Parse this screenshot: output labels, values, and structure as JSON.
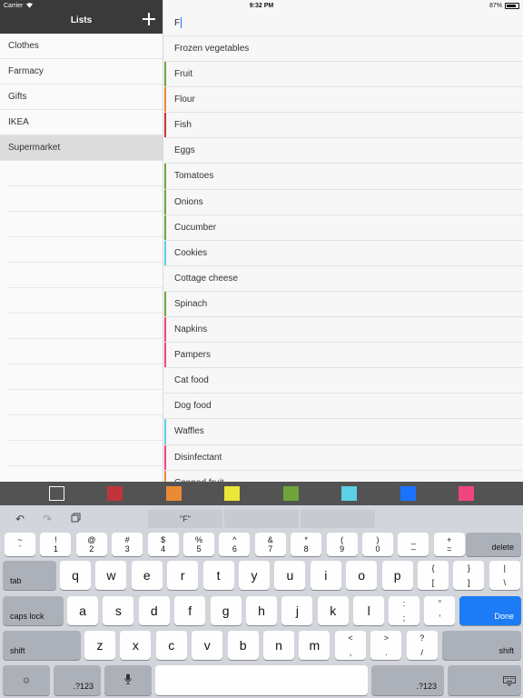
{
  "status": {
    "carrier": "Carrier",
    "time": "9:32 PM",
    "battery": "87%",
    "battery_level": 0.87
  },
  "sidebar": {
    "title": "Lists",
    "items": [
      {
        "label": "Clothes"
      },
      {
        "label": "Farmacy"
      },
      {
        "label": "Gifts"
      },
      {
        "label": "IKEA"
      },
      {
        "label": "Supermarket",
        "selected": true
      }
    ]
  },
  "main": {
    "input_value": "F",
    "items": [
      {
        "label": "Frozen vegetables",
        "color": ""
      },
      {
        "label": "Fruit",
        "color": "#6fa43a"
      },
      {
        "label": "Flour",
        "color": "#e98a35"
      },
      {
        "label": "Fish",
        "color": "#c0343c"
      },
      {
        "label": "Eggs",
        "color": ""
      },
      {
        "label": "Tomatoes",
        "color": "#6fa43a"
      },
      {
        "label": "Onions",
        "color": "#6fa43a"
      },
      {
        "label": "Cucumber",
        "color": "#6fa43a"
      },
      {
        "label": "Cookies",
        "color": "#5ad1e4"
      },
      {
        "label": "Cottage cheese",
        "color": ""
      },
      {
        "label": "Spinach",
        "color": "#6fa43a"
      },
      {
        "label": "Napkins",
        "color": "#f0457f"
      },
      {
        "label": "Pampers",
        "color": "#f0457f"
      },
      {
        "label": "Cat food",
        "color": ""
      },
      {
        "label": "Dog food",
        "color": ""
      },
      {
        "label": "Waffles",
        "color": "#5ad1e4"
      },
      {
        "label": "Disinfectant",
        "color": "#f0457f"
      },
      {
        "label": "Canned fruit",
        "color": "#e98a35"
      }
    ]
  },
  "colors": [
    "#ffffff",
    "#c0343c",
    "#e98a35",
    "#ece638",
    "#6fa43a",
    "#5ad1e4",
    "#1a73ff",
    "#f0457f"
  ],
  "keyboard": {
    "suggestion": "\"F\"",
    "row1": [
      {
        "top": "~",
        "bot": "`"
      },
      {
        "top": "!",
        "bot": "1"
      },
      {
        "top": "@",
        "bot": "2"
      },
      {
        "top": "#",
        "bot": "3"
      },
      {
        "top": "$",
        "bot": "4"
      },
      {
        "top": "%",
        "bot": "5"
      },
      {
        "top": "^",
        "bot": "6"
      },
      {
        "top": "&",
        "bot": "7"
      },
      {
        "top": "*",
        "bot": "8"
      },
      {
        "top": "(",
        "bot": "9"
      },
      {
        "top": ")",
        "bot": "0"
      },
      {
        "top": "_",
        "bot": "–"
      },
      {
        "top": "+",
        "bot": "="
      }
    ],
    "delete": "delete",
    "tab": "tab",
    "row2": [
      "q",
      "w",
      "e",
      "r",
      "t",
      "y",
      "u",
      "i",
      "o",
      "p"
    ],
    "row2_extra": [
      {
        "top": "{",
        "bot": "["
      },
      {
        "top": "}",
        "bot": "]"
      },
      {
        "top": "|",
        "bot": "\\"
      }
    ],
    "caps": "caps lock",
    "row3": [
      "a",
      "s",
      "d",
      "f",
      "g",
      "h",
      "j",
      "k",
      "l"
    ],
    "row3_extra": [
      {
        "top": ":",
        "bot": ";"
      },
      {
        "top": "”",
        "bot": "’"
      }
    ],
    "done": "Done",
    "shift": "shift",
    "row4": [
      "z",
      "x",
      "c",
      "v",
      "b",
      "n",
      "m"
    ],
    "row4_extra": [
      {
        "top": "<",
        "bot": ","
      },
      {
        "top": ">",
        "bot": "."
      },
      {
        "top": "?",
        "bot": "/"
      }
    ],
    "num": ".?123"
  }
}
